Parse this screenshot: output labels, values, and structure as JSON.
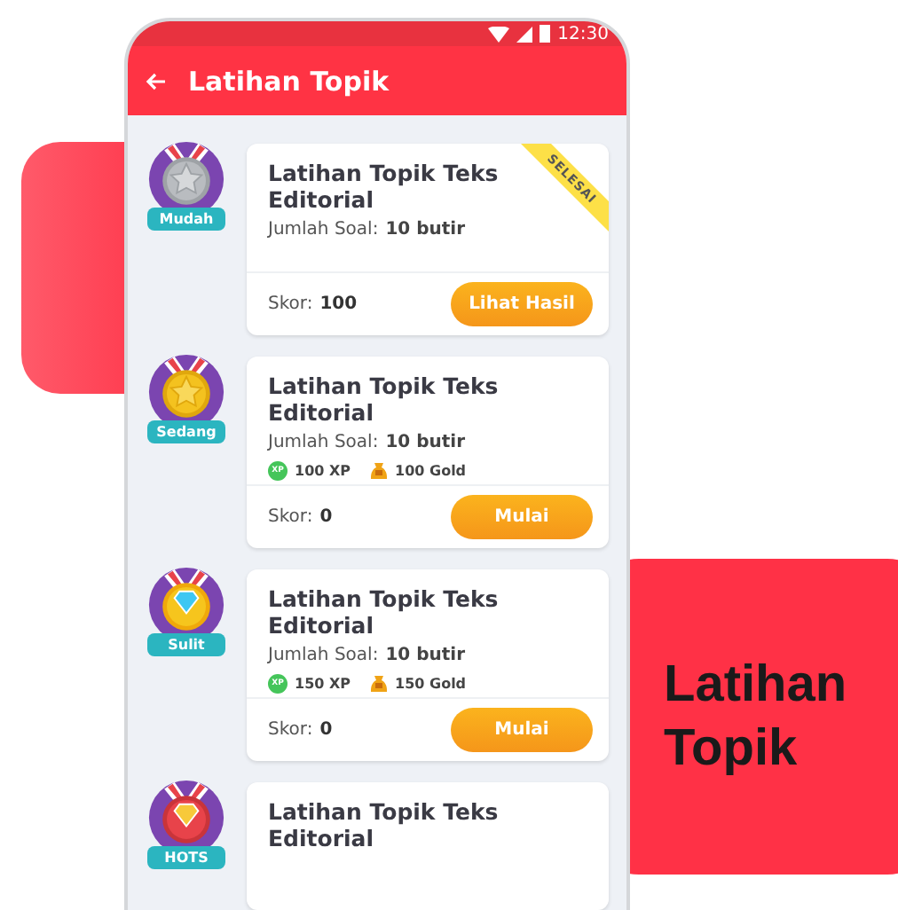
{
  "status_bar": {
    "time": "12:30"
  },
  "app_bar": {
    "title": "Latihan Topik"
  },
  "topics": [
    {
      "kind": "silver",
      "level_badge": "Mudah",
      "title": "Latihan Topik Teks Editorial",
      "question_label": "Jumlah Soal:",
      "question_count": "10 butir",
      "completed": true,
      "ribbon": "SELESAI",
      "score_label": "Skor:",
      "score": "100",
      "button": "Lihat Hasil"
    },
    {
      "kind": "gold",
      "level_badge": "Sedang",
      "title": "Latihan Topik Teks Editorial",
      "question_label": "Jumlah Soal:",
      "question_count": "10 butir",
      "rewards": [
        {
          "kind": "xp",
          "icon_text": "XP",
          "label": "100 XP"
        },
        {
          "kind": "gold",
          "label": "100 Gold"
        }
      ],
      "completed": false,
      "score_label": "Skor:",
      "score": "0",
      "button": "Mulai"
    },
    {
      "kind": "diamond",
      "level_badge": "Sulit",
      "title": "Latihan Topik Teks Editorial",
      "question_label": "Jumlah Soal:",
      "question_count": "10 butir",
      "rewards": [
        {
          "kind": "xp",
          "icon_text": "XP",
          "label": "150 XP"
        },
        {
          "kind": "gold",
          "label": "150 Gold"
        }
      ],
      "completed": false,
      "score_label": "Skor:",
      "score": "0",
      "button": "Mulai"
    },
    {
      "kind": "ruby",
      "level_badge": "HOTS",
      "title": "Latihan Topik Teks Editorial",
      "completed": false
    }
  ],
  "promo": {
    "title": "Latihan Topik"
  }
}
